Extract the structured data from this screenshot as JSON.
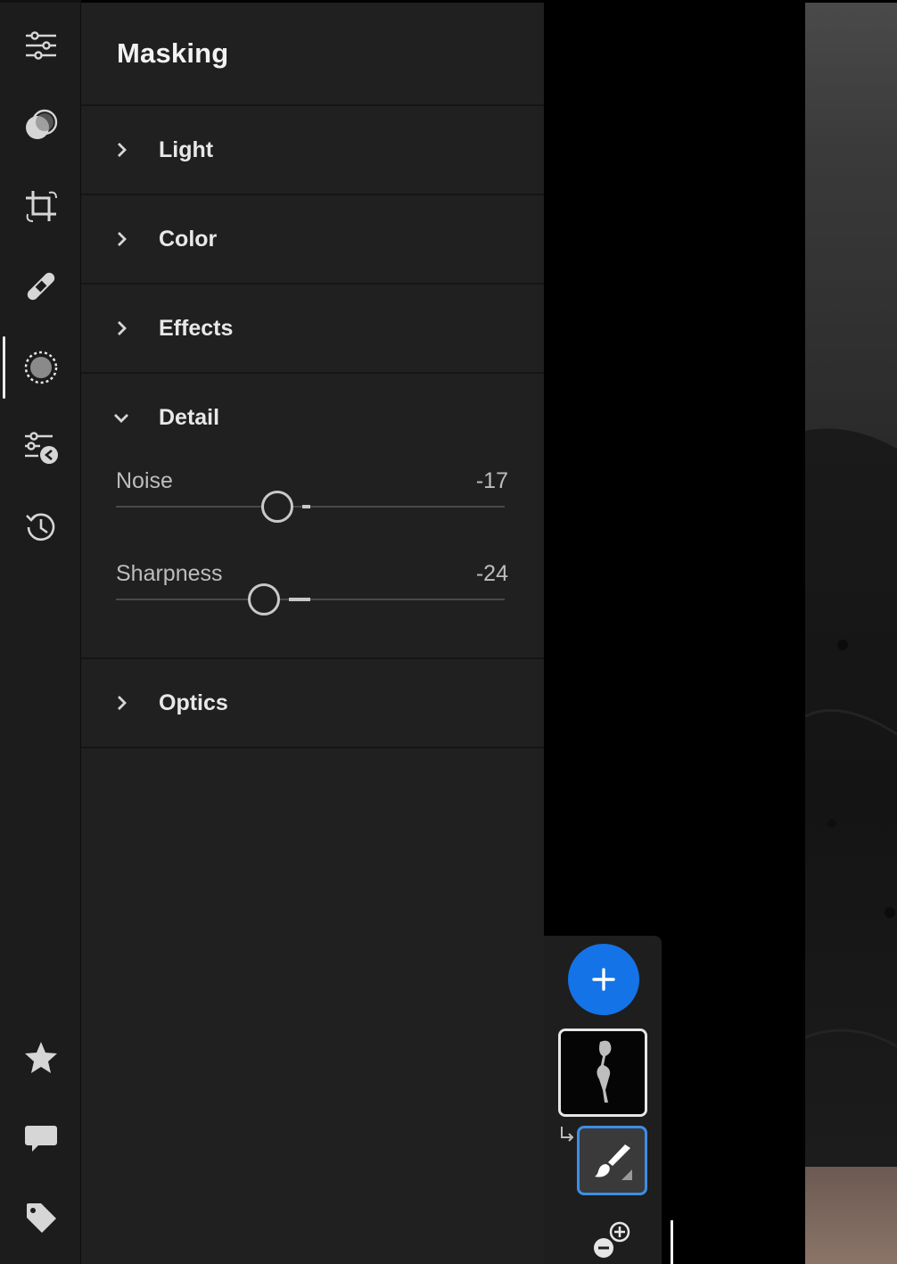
{
  "rail": {
    "items": [
      {
        "icon": "sliders-icon"
      },
      {
        "icon": "presets-icon"
      },
      {
        "icon": "crop-icon"
      },
      {
        "icon": "healing-icon"
      },
      {
        "icon": "masking-icon",
        "active": true
      },
      {
        "icon": "versions-icon"
      },
      {
        "icon": "history-icon"
      },
      {
        "icon": "star-icon"
      },
      {
        "icon": "comment-icon"
      },
      {
        "icon": "tag-icon"
      }
    ]
  },
  "panel": {
    "title": "Masking",
    "sections": {
      "light": "Light",
      "color": "Color",
      "effects": "Effects",
      "detail": "Detail",
      "optics": "Optics"
    },
    "detail": {
      "noise": {
        "label": "Noise",
        "value": "-17",
        "amount": -17
      },
      "sharpness": {
        "label": "Sharpness",
        "value": "-24",
        "amount": -24
      }
    }
  },
  "mask_panel": {
    "add_icon": "plus-icon",
    "brush_icon": "brush-icon",
    "subtract_icon": "add-subtract-icon"
  },
  "colors": {
    "accent": "#1473e6",
    "selection": "#3d8ee6"
  }
}
